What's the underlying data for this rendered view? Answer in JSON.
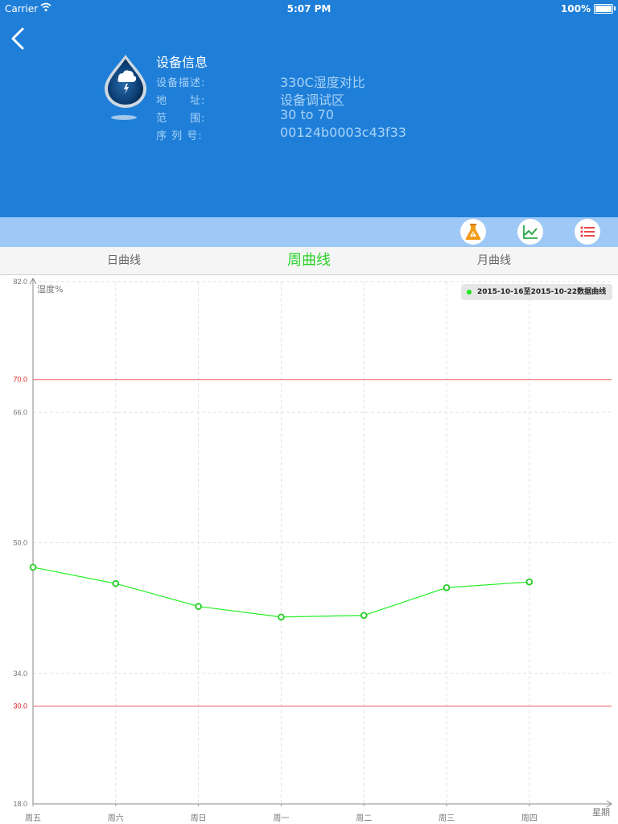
{
  "status": {
    "carrier": "Carrier",
    "time": "5:07 PM",
    "battery": "100%"
  },
  "device": {
    "title": "设备信息",
    "rows": [
      {
        "key": "设备描述:",
        "value": "330C湿度对比"
      },
      {
        "key": "地　　址:",
        "value": "设备调试区"
      },
      {
        "key": "范　　围:",
        "value": "30 to 70"
      },
      {
        "key": "序 列 号:",
        "value": "00124b0003c43f33"
      }
    ]
  },
  "toolbar": {
    "icons": [
      "flask-alert-icon",
      "line-chart-icon",
      "list-icon"
    ]
  },
  "tabs": [
    {
      "label": "日曲线",
      "active": false
    },
    {
      "label": "周曲线",
      "active": true
    },
    {
      "label": "月曲线",
      "active": false
    }
  ],
  "colors": {
    "header": "#1f7fd8",
    "toolbar": "#9ec8f5",
    "series": "#22ee22",
    "limit": "#f06060",
    "active_tab": "#2bd12b"
  },
  "chart_data": {
    "type": "line",
    "ylabel": "湿度%",
    "xlabel": "星期",
    "ylim": [
      18,
      82
    ],
    "yticks": [
      18.0,
      34.0,
      50.0,
      66.0,
      82.0
    ],
    "limit_lines": [
      70.0,
      30.0
    ],
    "categories": [
      "周五",
      "周六",
      "周日",
      "周一",
      "周二",
      "周三",
      "周四"
    ],
    "legend": "2015-10-16至2015-10-22数据曲线",
    "series": [
      {
        "name": "2015-10-16至2015-10-22数据曲线",
        "values": [
          47.0,
          45.0,
          42.2,
          40.9,
          41.1,
          44.5,
          45.2
        ]
      }
    ],
    "grid": true
  }
}
